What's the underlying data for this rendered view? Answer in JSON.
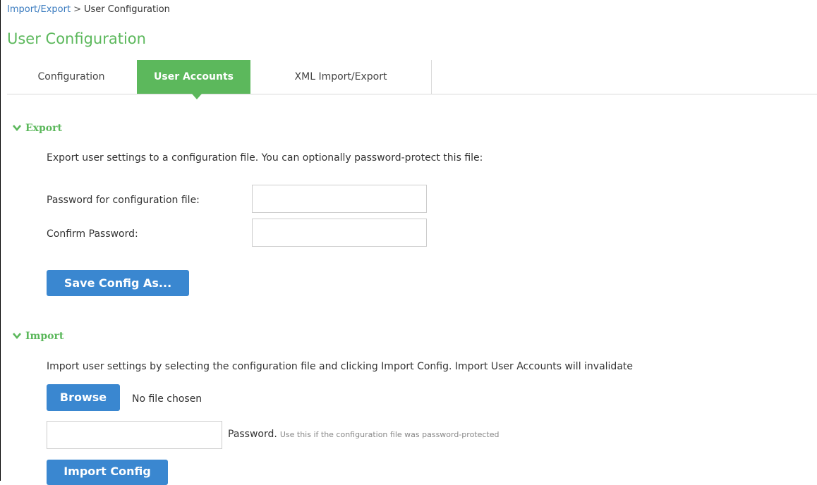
{
  "breadcrumb": {
    "parent": "Import/Export",
    "separator": ">",
    "current": "User Configuration"
  },
  "page_title": "User Configuration",
  "tabs": [
    {
      "label": "Configuration",
      "active": false
    },
    {
      "label": "User Accounts",
      "active": true
    },
    {
      "label": "XML Import/Export",
      "active": false
    }
  ],
  "export": {
    "heading": "Export",
    "description": "Export user settings to a configuration file. You can optionally password-protect this file:",
    "password_label": "Password for configuration file:",
    "password_value": "",
    "confirm_label": "Confirm Password:",
    "confirm_value": "",
    "save_button": "Save Config As..."
  },
  "import": {
    "heading": "Import",
    "description": "Import user settings by selecting the configuration file and clicking Import Config. Import User Accounts will invalidate",
    "browse_button": "Browse",
    "file_status": "No file chosen",
    "password_value": "",
    "password_label": "Password.",
    "password_hint": "Use this if the configuration file was password-protected",
    "import_button": "Import Config"
  },
  "colors": {
    "accent_green": "#5cb85c",
    "button_blue": "#3a87d0",
    "link_blue": "#3a7bbf"
  }
}
